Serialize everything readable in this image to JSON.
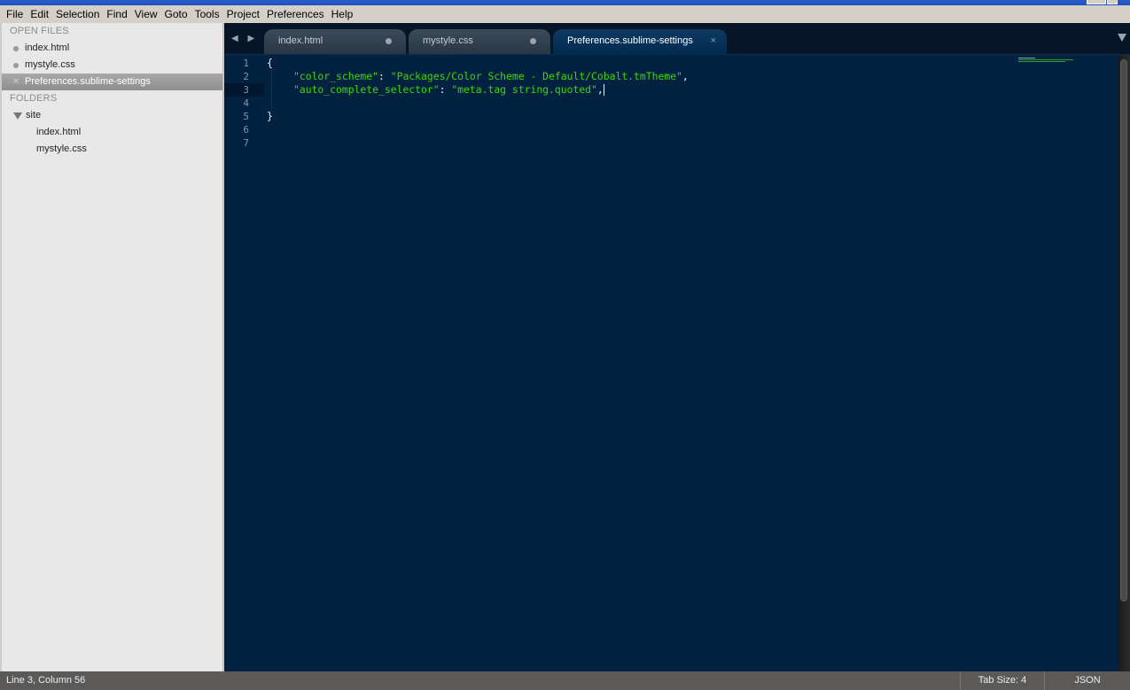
{
  "window": {
    "title_visible": false
  },
  "menu": [
    "File",
    "Edit",
    "Selection",
    "Find",
    "View",
    "Goto",
    "Tools",
    "Project",
    "Preferences",
    "Help"
  ],
  "sidebar": {
    "open_files_heading": "OPEN FILES",
    "open_files": [
      {
        "name": "index.html",
        "state": "modified"
      },
      {
        "name": "mystyle.css",
        "state": "modified"
      },
      {
        "name": "Preferences.sublime-settings",
        "state": "active"
      }
    ],
    "folders_heading": "FOLDERS",
    "folder": {
      "name": "site",
      "expanded": true,
      "files": [
        "index.html",
        "mystyle.css"
      ]
    }
  },
  "tabs": [
    {
      "label": "index.html",
      "indicator": "modified-dot"
    },
    {
      "label": "mystyle.css",
      "indicator": "modified-dot"
    },
    {
      "label": "Preferences.sublime-settings",
      "indicator": "close",
      "close_glyph": "×",
      "active": true
    }
  ],
  "nav_arrows": "◀ ▶",
  "editor": {
    "line_numbers": [
      "1",
      "2",
      "3",
      "4",
      "5",
      "6",
      "7"
    ],
    "current_line": 3,
    "lines": {
      "l1": "{",
      "l2_key": "\"color_scheme\"",
      "l2_sep": ": ",
      "l2_val": "\"Packages/Color Scheme - Default/Cobalt.tmTheme\"",
      "l2_end": ",",
      "l3_key": "\"auto_complete_selector\"",
      "l3_sep": ": ",
      "l3_val": "\"meta.tag string.quoted\"",
      "l3_end": ",",
      "l5": "}"
    },
    "colors": {
      "background": "#002240",
      "string": "#3ad900",
      "text": "#e1efff"
    }
  },
  "status": {
    "position": "Line 3, Column 56",
    "tab_size": "Tab Size: 4",
    "syntax": "JSON"
  }
}
